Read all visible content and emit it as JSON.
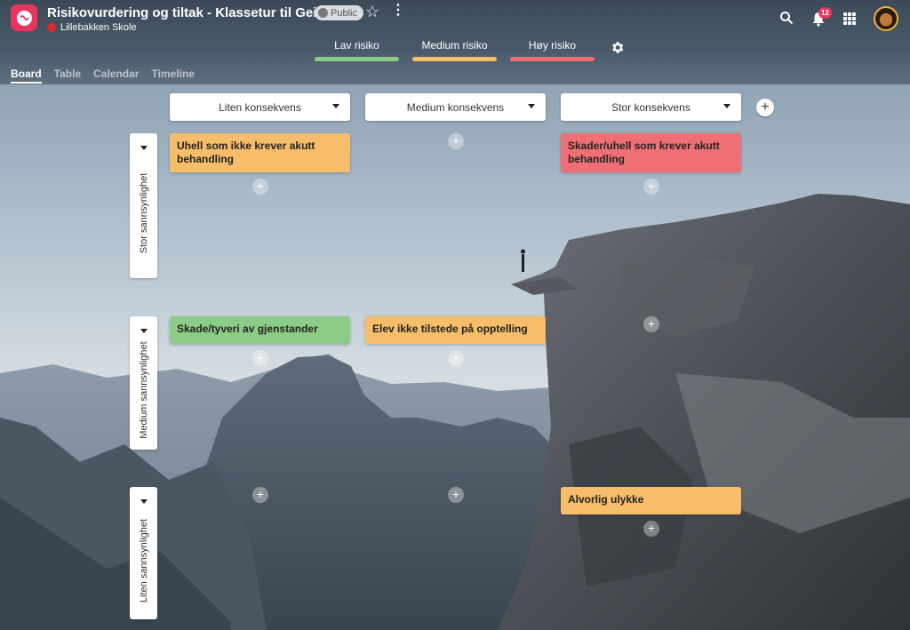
{
  "app": {
    "title": "Risikovurdering og tiltak - Klassetur til Geilo",
    "visibility": "Public",
    "organization": "Lillebakken Skole",
    "notification_count": "12"
  },
  "legend": [
    {
      "label": "Lav risiko",
      "color": "#8ccc87"
    },
    {
      "label": "Medium risiko",
      "color": "#f6bd6a"
    },
    {
      "label": "Høy risiko",
      "color": "#ee6f76"
    }
  ],
  "view_tabs": [
    "Board",
    "Table",
    "Calendar",
    "Timeline"
  ],
  "active_view": "Board",
  "columns": [
    "Liten konsekvens",
    "Medium konsekvens",
    "Stor konsekvens"
  ],
  "rows": [
    "Stor sannsynlighet",
    "Medium sannsynlighet",
    "Liten sannsynlighet"
  ],
  "cards": {
    "c_stor_liten": "Uhell som ikke krever akutt behandling",
    "c_stor_stor": "Skader/uhell som krever akutt behandling",
    "c_medium_liten": "Skade/tyveri av gjenstander",
    "c_medium_medium": "Elev ikke tilstede på opptelling",
    "c_liten_stor": "Alvorlig ulykke"
  },
  "colors": {
    "low": "#8ccc87",
    "medium": "#f6bd6a",
    "high": "#ee6f76",
    "brand": "#e8365e",
    "org_dot": "#e02b2b"
  },
  "icons": [
    "app-logo-icon",
    "globe-icon",
    "star-icon",
    "more-vert-icon",
    "search-icon",
    "bell-icon",
    "apps-grid-icon",
    "settings-gear-icon",
    "caret-down-icon",
    "plus-icon"
  ]
}
